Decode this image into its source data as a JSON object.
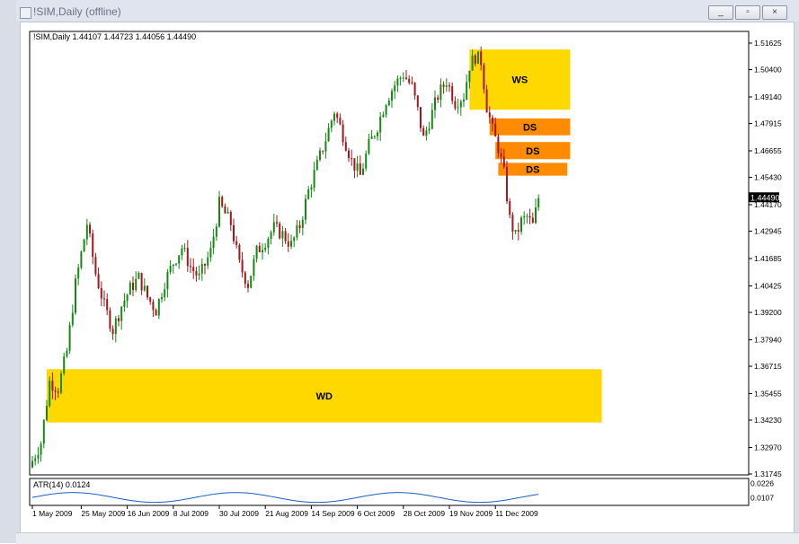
{
  "window": {
    "title": "!SIM,Daily (offline)",
    "buttons": {
      "minimize": "_",
      "restore": "▫",
      "close": "×"
    }
  },
  "chart_info": "!SIM,Daily  1.44107 1.44723 1.44056 1.44490",
  "indicator_label": "ATR(14) 0.0124",
  "current_price_label": "1.44490",
  "zones": [
    {
      "label": "WS",
      "color": "#ffd800"
    },
    {
      "label": "DS",
      "color": "#ff8c00"
    },
    {
      "label": "DS",
      "color": "#ff8c00"
    },
    {
      "label": "DS",
      "color": "#ff8c00"
    },
    {
      "label": "WD",
      "color": "#ffd800"
    }
  ],
  "colors": {
    "bull": "#138a13",
    "bear": "#a3161b",
    "zone_yellow": "#ffd800",
    "zone_orange": "#ff8c00"
  },
  "chart_data": {
    "type": "candlestick",
    "ylim": [
      1.31745,
      1.51625
    ],
    "y_ticks": [
      {
        "value": 1.51625,
        "label": "1.51625"
      },
      {
        "value": 1.504,
        "label": "1.50400"
      },
      {
        "value": 1.4914,
        "label": "1.49140"
      },
      {
        "value": 1.47915,
        "label": "1.47915"
      },
      {
        "value": 1.46655,
        "label": "1.46655"
      },
      {
        "value": 1.4543,
        "label": "1.45430"
      },
      {
        "value": 1.4417,
        "label": "1.44170"
      },
      {
        "value": 1.42945,
        "label": "1.42945"
      },
      {
        "value": 1.41685,
        "label": "1.41685"
      },
      {
        "value": 1.40425,
        "label": "1.40425"
      },
      {
        "value": 1.392,
        "label": "1.39200"
      },
      {
        "value": 1.3794,
        "label": "1.37940"
      },
      {
        "value": 1.36715,
        "label": "1.36715"
      },
      {
        "value": 1.35455,
        "label": "1.35455"
      },
      {
        "value": 1.3423,
        "label": "1.34230"
      },
      {
        "value": 1.3297,
        "label": "1.32970"
      },
      {
        "value": 1.31745,
        "label": "1.31745"
      }
    ],
    "x_labels": [
      "1 May 2009",
      "25 May 2009",
      "16 Jun 2009",
      "8 Jul 2009",
      "30 Jul 2009",
      "21 Aug 2009",
      "14 Sep 2009",
      "6 Oct 2009",
      "28 Oct 2009",
      "19 Nov 2009",
      "11 Dec 2009"
    ],
    "x_label_bars": [
      0,
      17,
      33,
      49,
      65,
      81,
      97,
      113,
      129,
      145,
      161
    ],
    "zones": [
      {
        "label": "WS",
        "bar_from": 152,
        "bar_to": 187,
        "y_top": 1.5133,
        "y_bottom": 1.4855
      },
      {
        "label": "DS",
        "bar_from": 159,
        "bar_to": 187,
        "y_top": 1.4815,
        "y_bottom": 1.4737
      },
      {
        "label": "DS",
        "bar_from": 161,
        "bar_to": 187,
        "y_top": 1.4706,
        "y_bottom": 1.4627
      },
      {
        "label": "DS",
        "bar_from": 162,
        "bar_to": 186,
        "y_top": 1.461,
        "y_bottom": 1.4551
      },
      {
        "label": "WD",
        "bar_from": 5,
        "bar_to": 198,
        "y_top": 1.3658,
        "y_bottom": 1.3412
      }
    ],
    "close_waypoints": [
      [
        0,
        1.3235
      ],
      [
        3,
        1.332
      ],
      [
        6,
        1.36
      ],
      [
        9,
        1.357
      ],
      [
        12,
        1.374
      ],
      [
        15,
        1.405
      ],
      [
        19,
        1.433
      ],
      [
        22,
        1.41
      ],
      [
        25,
        1.395
      ],
      [
        28,
        1.384
      ],
      [
        31,
        1.395
      ],
      [
        34,
        1.403
      ],
      [
        37,
        1.408
      ],
      [
        40,
        1.399
      ],
      [
        43,
        1.393
      ],
      [
        46,
        1.406
      ],
      [
        49,
        1.415
      ],
      [
        52,
        1.422
      ],
      [
        55,
        1.413
      ],
      [
        58,
        1.408
      ],
      [
        62,
        1.42
      ],
      [
        65,
        1.442
      ],
      [
        69,
        1.433
      ],
      [
        72,
        1.414
      ],
      [
        75,
        1.405
      ],
      [
        78,
        1.42
      ],
      [
        81,
        1.425
      ],
      [
        84,
        1.431
      ],
      [
        87,
        1.428
      ],
      [
        90,
        1.423
      ],
      [
        93,
        1.432
      ],
      [
        96,
        1.448
      ],
      [
        99,
        1.46
      ],
      [
        102,
        1.472
      ],
      [
        105,
        1.485
      ],
      [
        108,
        1.474
      ],
      [
        111,
        1.462
      ],
      [
        114,
        1.455
      ],
      [
        117,
        1.469
      ],
      [
        120,
        1.478
      ],
      [
        123,
        1.49
      ],
      [
        126,
        1.497
      ],
      [
        129,
        1.502
      ],
      [
        132,
        1.496
      ],
      [
        134,
        1.485
      ],
      [
        136,
        1.472
      ],
      [
        138,
        1.48
      ],
      [
        141,
        1.492
      ],
      [
        144,
        1.499
      ],
      [
        147,
        1.489
      ],
      [
        150,
        1.492
      ],
      [
        152,
        1.506
      ],
      [
        154,
        1.51
      ],
      [
        156,
        1.508
      ],
      [
        158,
        1.487
      ],
      [
        160,
        1.476
      ],
      [
        162,
        1.468
      ],
      [
        164,
        1.456
      ],
      [
        166,
        1.435
      ],
      [
        168,
        1.427
      ],
      [
        170,
        1.434
      ],
      [
        172,
        1.436
      ],
      [
        174,
        1.432
      ],
      [
        176,
        1.4449
      ]
    ],
    "volatility": 0.0068,
    "atr_ticks": [
      {
        "value": 0.0226,
        "label": "0.0226"
      },
      {
        "value": 0.0107,
        "label": "0.0107"
      }
    ],
    "atr_ylim": [
      0.006,
      0.025
    ]
  }
}
